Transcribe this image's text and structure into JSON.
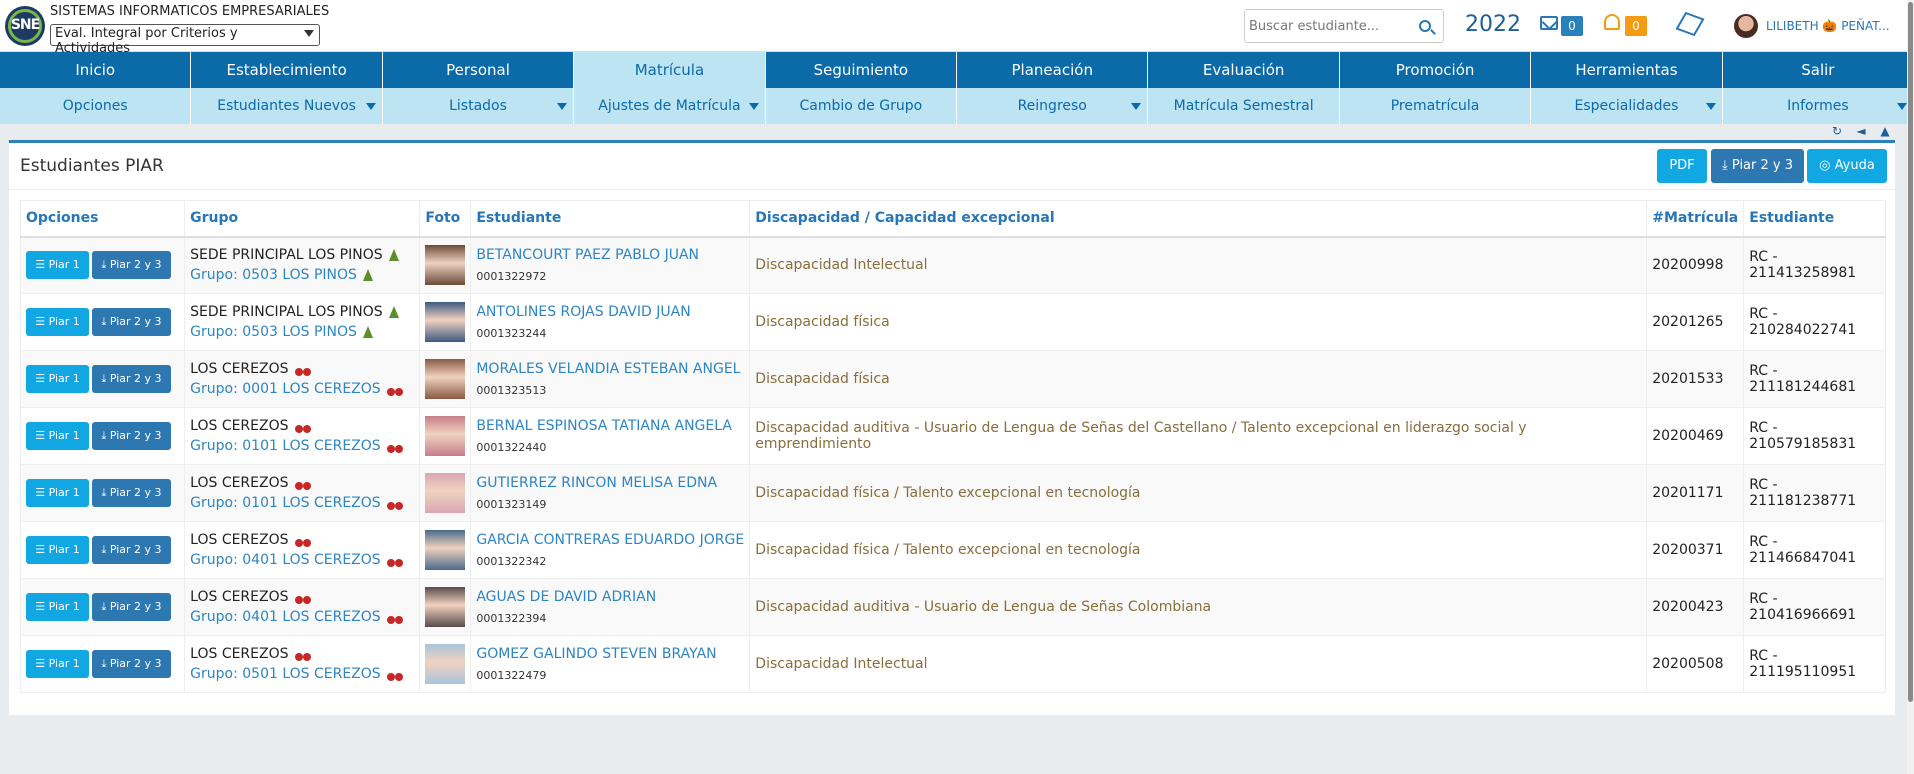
{
  "header": {
    "logo_text": "SNE",
    "company": "SISTEMAS INFORMATICOS EMPRESARIALES",
    "eval_select": "Eval. Integral por Criterios y Actividades",
    "search_placeholder": "Buscar estudiante...",
    "year": "2022",
    "mail_count": "0",
    "bell_count": "0",
    "user_name": "LILIBETH 🎃 PEÑAT..."
  },
  "main_menu": [
    "Inicio",
    "Establecimiento",
    "Personal",
    "Matrícula",
    "Seguimiento",
    "Planeación",
    "Evaluación",
    "Promoción",
    "Herramientas",
    "Salir"
  ],
  "main_menu_active": "Matrícula",
  "sub_menu": [
    {
      "label": "Opciones",
      "caret": false
    },
    {
      "label": "Estudiantes Nuevos",
      "caret": true
    },
    {
      "label": "Listados",
      "caret": true
    },
    {
      "label": "Ajustes de Matrícula",
      "caret": true
    },
    {
      "label": "Cambio de Grupo",
      "caret": false
    },
    {
      "label": "Reingreso",
      "caret": true
    },
    {
      "label": "Matrícula Semestral",
      "caret": false
    },
    {
      "label": "Prematrícula",
      "caret": false
    },
    {
      "label": "Especialidades",
      "caret": true
    },
    {
      "label": "Informes",
      "caret": true
    }
  ],
  "panel": {
    "title": "Estudiantes PIAR",
    "pdf_label": "PDF",
    "piar23_label": "Piar 2 y 3",
    "help_label": "Ayuda"
  },
  "table": {
    "headers": [
      "Opciones",
      "Grupo",
      "Foto",
      "Estudiante",
      "Discapacidad / Capacidad excepcional",
      "#Matrícula",
      "Estudiante"
    ],
    "btn_piar1": "Piar 1",
    "btn_piar23": "Piar 2 y 3",
    "rows": [
      {
        "sede": "SEDE PRINCIPAL LOS PINOS",
        "grupo": "Grupo: 0503 LOS PINOS",
        "emblem": "tree",
        "name": "BETANCOURT PAEZ PABLO JUAN",
        "code": "0001322972",
        "disc": "Discapacidad Intelectual",
        "matricula": "20200998",
        "doc": "RC - 211413258981",
        "photo": "#6b4a3a"
      },
      {
        "sede": "SEDE PRINCIPAL LOS PINOS",
        "grupo": "Grupo: 0503 LOS PINOS",
        "emblem": "tree",
        "name": "ANTOLINES ROJAS DAVID JUAN",
        "code": "0001323244",
        "disc": "Discapacidad física",
        "matricula": "20201265",
        "doc": "RC - 210284022741",
        "photo": "#3d5a80"
      },
      {
        "sede": "LOS CEREZOS",
        "grupo": "Grupo: 0001 LOS CEREZOS",
        "emblem": "cherry",
        "name": "MORALES VELANDIA ESTEBAN ANGEL",
        "code": "0001323513",
        "disc": "Discapacidad física",
        "matricula": "20201533",
        "doc": "RC - 211181244681",
        "photo": "#8a5a44"
      },
      {
        "sede": "LOS CEREZOS",
        "grupo": "Grupo: 0101 LOS CEREZOS",
        "emblem": "cherry",
        "name": "BERNAL ESPINOSA TATIANA ANGELA",
        "code": "0001322440",
        "disc": "Discapacidad auditiva - Usuario de Lengua de Señas del Castellano / Talento excepcional en liderazgo social y emprendimiento",
        "matricula": "20200469",
        "doc": "RC - 210579185831",
        "photo": "#c77d8a"
      },
      {
        "sede": "LOS CEREZOS",
        "grupo": "Grupo: 0101 LOS CEREZOS",
        "emblem": "cherry",
        "name": "GUTIERREZ RINCON MELISA EDNA",
        "code": "0001323149",
        "disc": "Discapacidad física / Talento excepcional en tecnología",
        "matricula": "20201171",
        "doc": "RC - 211181238771",
        "photo": "#d9a7b3"
      },
      {
        "sede": "LOS CEREZOS",
        "grupo": "Grupo: 0401 LOS CEREZOS",
        "emblem": "cherry",
        "name": "GARCIA CONTRERAS EDUARDO JORGE",
        "code": "0001322342",
        "disc": "Discapacidad física / Talento excepcional en tecnología",
        "matricula": "20200371",
        "doc": "RC - 211466847041",
        "photo": "#4a6a8a"
      },
      {
        "sede": "LOS CEREZOS",
        "grupo": "Grupo: 0401 LOS CEREZOS",
        "emblem": "cherry",
        "name": "AGUAS DE DAVID ADRIAN",
        "code": "0001322394",
        "disc": "Discapacidad auditiva - Usuario de Lengua de Señas Colombiana",
        "matricula": "20200423",
        "doc": "RC - 210416966691",
        "photo": "#5a4a4a"
      },
      {
        "sede": "LOS CEREZOS",
        "grupo": "Grupo: 0501 LOS CEREZOS",
        "emblem": "cherry",
        "name": "GOMEZ GALINDO STEVEN BRAYAN",
        "code": "0001322479",
        "disc": "Discapacidad Intelectual",
        "matricula": "20200508",
        "doc": "RC - 211195110951",
        "photo": "#a9c4dc"
      }
    ]
  }
}
